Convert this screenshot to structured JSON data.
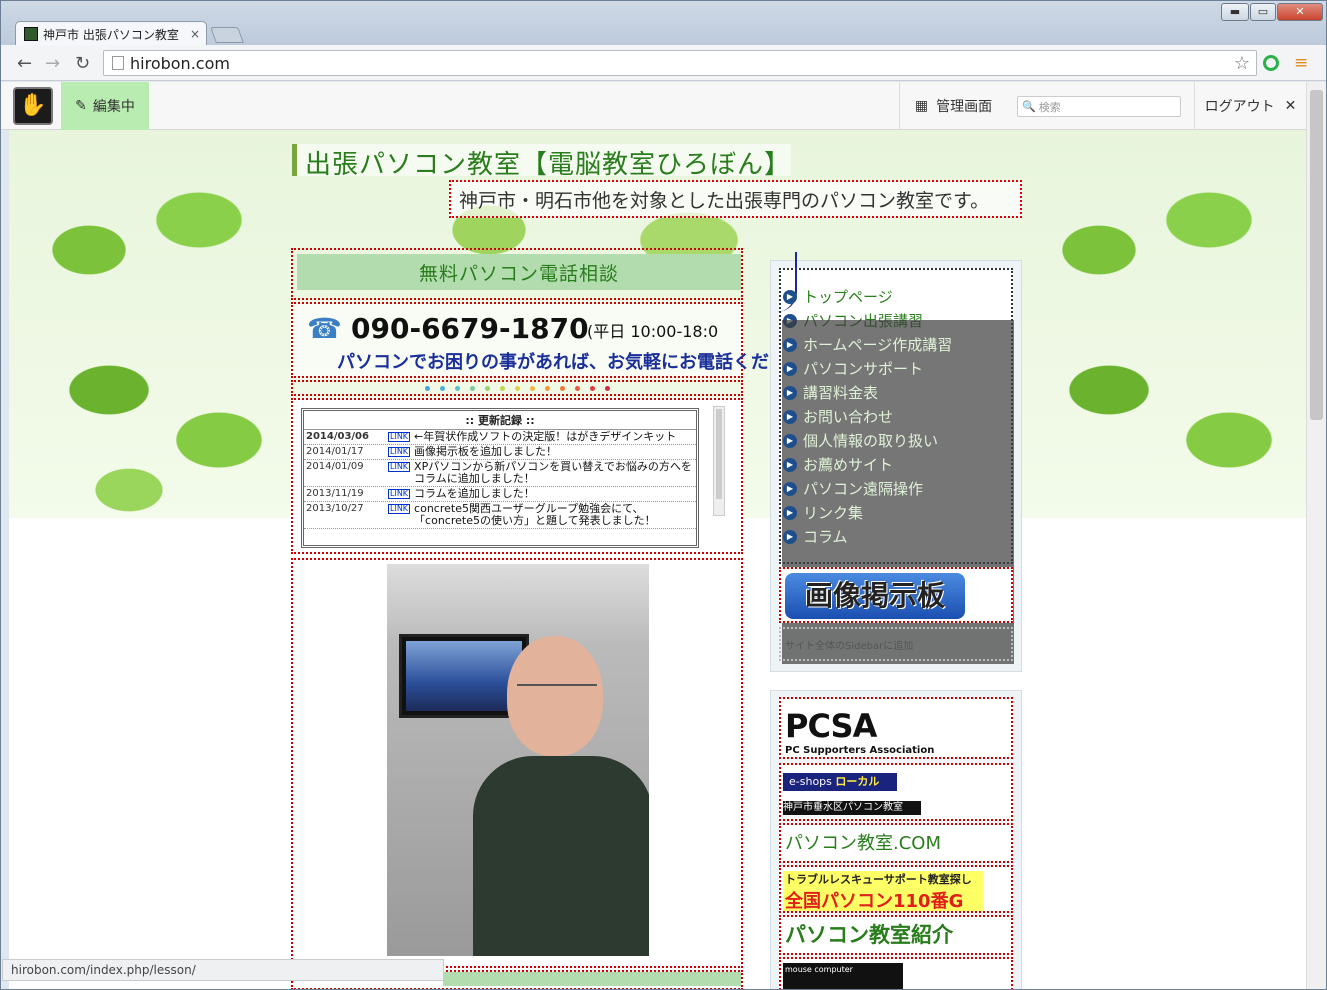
{
  "browser": {
    "tab_title": "神戸市 出張パソコン教室",
    "tab_close": "×",
    "url": "hirobon.com",
    "status_url": "hirobon.com/index.php/lesson/",
    "window_buttons": {
      "min": "▬",
      "max": "▭",
      "close": "✕"
    }
  },
  "cms_toolbar": {
    "editing_label": "編集中",
    "admin_label": "管理画面",
    "search_placeholder": "検索",
    "logout_label": "ログアウト",
    "logout_close": "✕"
  },
  "header": {
    "title": "出張パソコン教室【電脳教室ひろぼん】",
    "subtitle": "神戸市・明石市他を対象とした出張専門のパソコン教室です。"
  },
  "consult": {
    "label": "無料パソコン電話相談"
  },
  "phone": {
    "number": "090-6679-1870",
    "hours": "(平日 10:00-18:0",
    "note": "パソコンでお困りの事があれば、お気軽にお電話ください。"
  },
  "news": {
    "heading": ":: 更新記録 ::",
    "link_badge": "LINK",
    "items": [
      {
        "date": "2014/03/06",
        "text": "←年賀状作成ソフトの決定版！はがきデザインキット"
      },
      {
        "date": "2014/01/17",
        "text": "画像掲示板を追加しました！"
      },
      {
        "date": "2014/01/09",
        "text": "XPパソコンから新パソコンを買い替えでお悩みの方へをコラムに追加しました！"
      },
      {
        "date": "2013/11/19",
        "text": "コラムを追加しました！"
      },
      {
        "date": "2013/10/27",
        "text": "concrete5関西ユーザーグループ勉強会にて、「concrete5の使い方」と題して発表しました！"
      }
    ]
  },
  "sidebar": {
    "nav": [
      "トップページ",
      "パソコン出張講習",
      "ホームページ作成講習",
      "パソコンサポート",
      "講習料金表",
      "お問い合わせ",
      "個人情報の取り扱い",
      "お薦めサイト",
      "パソコン遠隔操作",
      "リンク集",
      "コラム"
    ],
    "bbs_label": "画像掲示板",
    "add_note": "サイト全体のSidebarに追加"
  },
  "banners": {
    "pcsa_logo": "PCSA",
    "pcsa_sub": "PC Supporters Association",
    "eshops_a": "e-shops",
    "eshops_a2": "ローカル",
    "eshops_b": "神戸市垂水区パソコン教室",
    "pckyoshitsu": "パソコン教室.COM",
    "trouble_top": "トラブルレスキューサポート教室探し",
    "trouble_main": "全国パソコン110番G",
    "shokai": "パソコン教室紹介",
    "mouse": "mouse computer"
  },
  "colors": {
    "accent_green": "#2a7d1c",
    "dotted_border": "#cc0000",
    "edit_bg": "#b8ecb0"
  }
}
